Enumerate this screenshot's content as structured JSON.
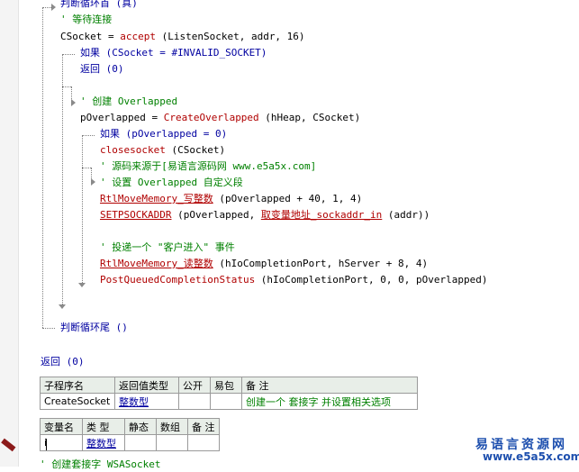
{
  "code": {
    "loop_head": "判断循环首 (真)",
    "c_wait": "' 等待连接",
    "accept_prefix": "CSocket = ",
    "accept_fn": "accept",
    "accept_args": " (ListenSocket, addr, 16)",
    "if1": "如果 (CSocket = #INVALID_SOCKET)",
    "return0": "返回 (0)",
    "c_create": "' 创建 Overlapped",
    "create_prefix": "pOverlapped = ",
    "create_fn": "CreateOverlapped",
    "create_args": " (hHeap, CSocket)",
    "if2": "如果 (pOverlapped = 0)",
    "closesocket_fn": "closesocket",
    "closesocket_args": " (CSocket)",
    "c_source": "' 源码来源于[易语言源码网 www.e5a5x.com]",
    "c_setfield": "' 设置 Overlapped 自定义段",
    "rtl_write_fn": "RtlMoveMemory_写整数",
    "rtl_write_args": " (pOverlapped + 40, 1, 4)",
    "setsock_fn": "SETPSOCKADDR",
    "setsock_mid": " (pOverlapped, ",
    "setsock_fn2": "取变量地址_sockaddr_in",
    "setsock_end": " (addr))",
    "c_post": "' 投递一个 \"客户进入\" 事件",
    "rtl_read_fn": "RtlMoveMemory_读整数",
    "rtl_read_args": " (hIoCompletionPort, hServer + 8, 4)",
    "post_fn": "PostQueuedCompletionStatus",
    "post_args": " (hIoCompletionPort, 0, 0, pOverlapped)",
    "loop_tail": "判断循环尾 ()",
    "return_end": "返回 (0)"
  },
  "sub_table": {
    "headers": [
      "子程序名",
      "返回值类型",
      "公开",
      "易包",
      "备 注"
    ],
    "row": [
      "CreateSocket",
      "整数型",
      "",
      "",
      "创建一个 套接字 并设置相关选项"
    ]
  },
  "var_table": {
    "headers": [
      "变量名",
      "类 型",
      "静态",
      "数组",
      "备 注"
    ],
    "row": [
      "i",
      "整数型",
      "",
      "",
      ""
    ]
  },
  "bottom_comment": "' 创建套接字 WSASocket",
  "watermark": {
    "cn": "易语言资源网",
    "en": "www.e5a5x.com"
  },
  "colors": {
    "comment": "#008000",
    "keyword": "#0000a0",
    "function": "#b00000",
    "table_header_bg": "#e8eee8",
    "watermark": "#1d4fae"
  }
}
